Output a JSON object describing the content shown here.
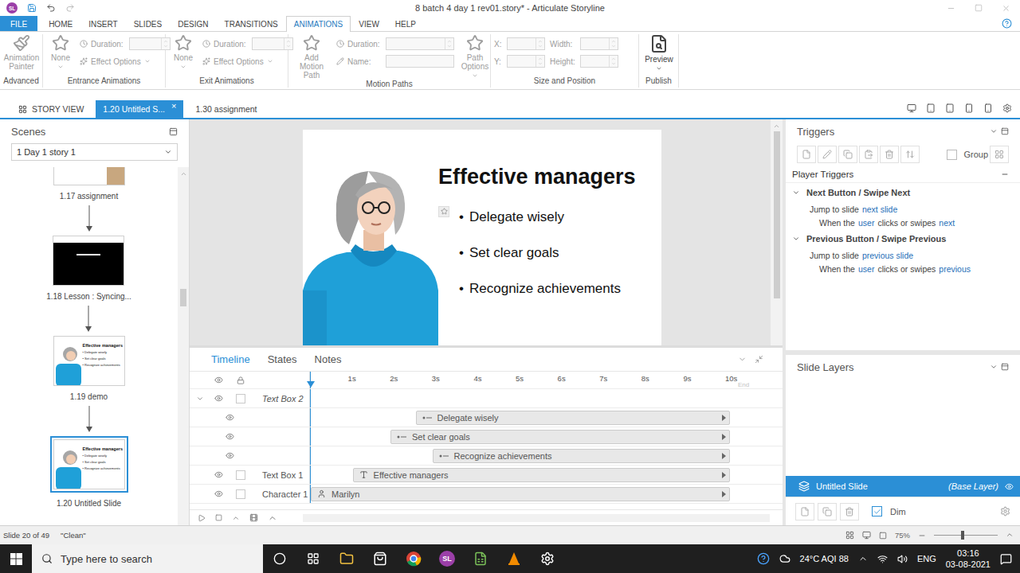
{
  "window": {
    "title": "8 batch 4 day 1 rev01.story* - Articulate Storyline",
    "app_badge": "SL"
  },
  "ribbon_tabs": [
    {
      "label": "FILE",
      "selected": false,
      "kind": "file"
    },
    {
      "label": "HOME",
      "selected": false,
      "kind": "tab"
    },
    {
      "label": "INSERT",
      "selected": false,
      "kind": "tab"
    },
    {
      "label": "SLIDES",
      "selected": false,
      "kind": "tab"
    },
    {
      "label": "DESIGN",
      "selected": false,
      "kind": "tab"
    },
    {
      "label": "TRANSITIONS",
      "selected": false,
      "kind": "tab"
    },
    {
      "label": "ANIMATIONS",
      "selected": true,
      "kind": "tab"
    },
    {
      "label": "VIEW",
      "selected": false,
      "kind": "tab"
    },
    {
      "label": "HELP",
      "selected": false,
      "kind": "tab"
    }
  ],
  "ribbon": {
    "advanced": {
      "button": "Animation Painter",
      "label": "Advanced",
      "disabled": true
    },
    "entrance": {
      "effect": "None",
      "duration": "Duration:",
      "options": "Effect Options",
      "label": "Entrance Animations",
      "disabled": true
    },
    "exit": {
      "effect": "None",
      "duration": "Duration:",
      "options": "Effect Options",
      "label": "Exit Animations",
      "disabled": true
    },
    "motion": {
      "add": "Add Motion Path",
      "duration": "Duration:",
      "name": "Name:",
      "path_options": "Path Options",
      "label": "Motion Paths",
      "disabled": true
    },
    "size": {
      "fields": [
        "X:",
        "Y:",
        "Width:",
        "Height:"
      ],
      "label": "Size and Position",
      "disabled": true
    },
    "publish": {
      "preview": "Preview",
      "label": "Publish",
      "disabled": false
    }
  },
  "doc_tabs": [
    {
      "label": "STORY VIEW",
      "selected": false,
      "kind": "story"
    },
    {
      "label": "1.20 Untitled S...",
      "selected": true,
      "kind": "slide",
      "close": "×"
    },
    {
      "label": "1.30 assignment",
      "selected": false,
      "kind": "slide"
    }
  ],
  "scenes": {
    "title": "Scenes",
    "scene": "1 Day 1 story 1",
    "slides": [
      {
        "label": "1.17 assignment",
        "selected": false,
        "kind": "buttons"
      },
      {
        "label": "1.18 Lesson : Syncing...",
        "selected": false,
        "kind": "dark"
      },
      {
        "label": "1.19 demo",
        "selected": false,
        "kind": "content"
      },
      {
        "label": "1.20 Untitled Slide",
        "selected": true,
        "kind": "content"
      }
    ]
  },
  "slide": {
    "title": "Effective managers",
    "bullet": "•",
    "bullets": [
      "Delegate wisely",
      "Set clear goals",
      "Recognize achievements"
    ],
    "animation_marker": true
  },
  "timeline": {
    "tabs": [
      {
        "label": "Timeline",
        "selected": true
      },
      {
        "label": "States",
        "selected": false
      },
      {
        "label": "Notes",
        "selected": false
      }
    ],
    "ticks": [
      "1s",
      "2s",
      "3s",
      "4s",
      "5s",
      "6s",
      "7s",
      "8s",
      "9s",
      "10s"
    ],
    "end_label": "End",
    "duration": 10,
    "rows": [
      {
        "name": "Text Box 2",
        "kind": "group",
        "expanded": true,
        "visible": true,
        "locked": false
      },
      {
        "kind": "bullet",
        "visible": true,
        "bar": "Delegate wisely",
        "start": 2.5
      },
      {
        "kind": "bullet",
        "visible": true,
        "bar": "Set clear goals",
        "start": 1.9
      },
      {
        "kind": "bullet",
        "visible": true,
        "bar": "Recognize achievements",
        "start": 2.9
      },
      {
        "name": "Text Box 1",
        "kind": "text",
        "visible": true,
        "locked": false,
        "bar": "Effective managers",
        "start": 1.0
      },
      {
        "name": "Character 1",
        "kind": "character",
        "visible": true,
        "locked": false,
        "bar": "Marilyn",
        "start": 0
      }
    ]
  },
  "triggers": {
    "title": "Triggers",
    "group": {
      "label": "Group",
      "checked": false
    },
    "section": "Player Triggers",
    "items": [
      {
        "title": "Next Button / Swipe Next",
        "expanded": true,
        "action": "Jump to slide",
        "target": "next slide",
        "condition": [
          {
            "text": "When the",
            "link": false
          },
          {
            "text": "user",
            "link": true
          },
          {
            "text": "clicks or swipes",
            "link": false
          },
          {
            "text": "next",
            "link": true
          }
        ]
      },
      {
        "title": "Previous Button / Swipe Previous",
        "expanded": true,
        "action": "Jump to slide",
        "target": "previous slide",
        "condition": [
          {
            "text": "When the",
            "link": false
          },
          {
            "text": "user",
            "link": true
          },
          {
            "text": "clicks or swipes",
            "link": false
          },
          {
            "text": "previous",
            "link": true
          }
        ]
      }
    ]
  },
  "layers": {
    "title": "Slide Layers",
    "items": [
      {
        "name": "Untitled Slide",
        "tag": "(Base Layer)",
        "selected": true,
        "visible": true
      }
    ],
    "dim": {
      "label": "Dim",
      "checked": true
    }
  },
  "status_bar": {
    "slide": "Slide 20 of 49",
    "theme": "\"Clean\"",
    "zoom": "75%",
    "zoom_level": 0.45
  },
  "taskbar": {
    "search": "Type here to search",
    "weather": "24°C AQI 88",
    "lang": "ENG",
    "time": "03:16",
    "date": "03-08-2021"
  }
}
